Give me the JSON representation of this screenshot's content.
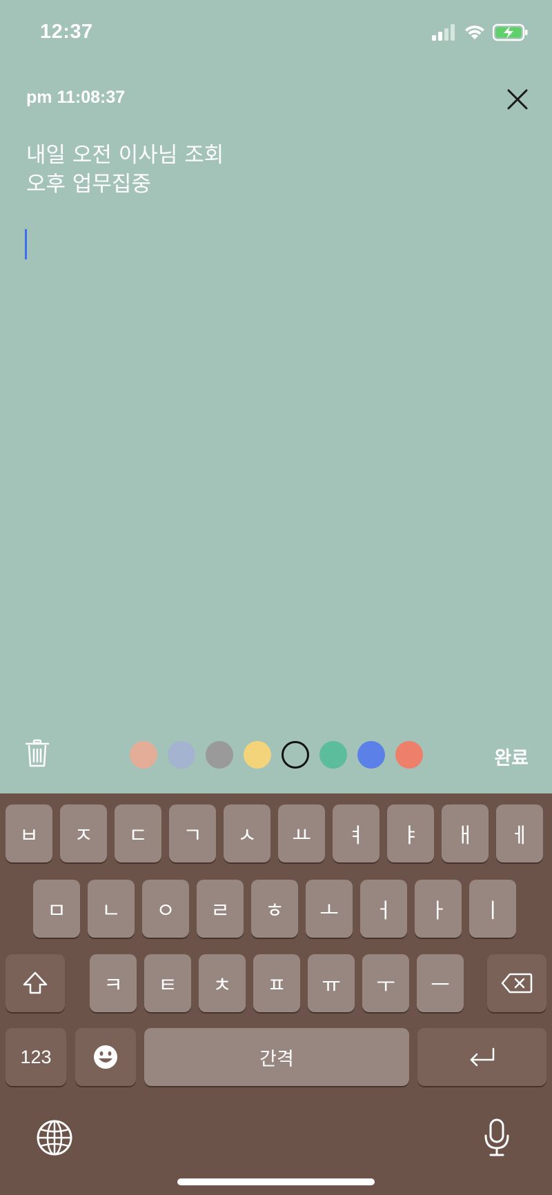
{
  "status_bar": {
    "time": "12:37"
  },
  "memo": {
    "timestamp": "pm 11:08:37",
    "lines": [
      "내일 오전 이사님 조회",
      "오후 업무집중"
    ]
  },
  "toolbar": {
    "done_label": "완료",
    "colors": [
      "#e4ad98",
      "#a4b3d0",
      "#9a9a9a",
      "#f4d47a",
      "#a3c2b8",
      "#5bbd9b",
      "#5b80e8",
      "#ee806b"
    ],
    "selected_color_index": 4
  },
  "keyboard": {
    "row1": [
      "ㅂ",
      "ㅈ",
      "ㄷ",
      "ㄱ",
      "ㅅ",
      "ㅛ",
      "ㅕ",
      "ㅑ",
      "ㅐ",
      "ㅔ"
    ],
    "row2": [
      "ㅁ",
      "ㄴ",
      "ㅇ",
      "ㄹ",
      "ㅎ",
      "ㅗ",
      "ㅓ",
      "ㅏ",
      "ㅣ"
    ],
    "row3": [
      "ㅋ",
      "ㅌ",
      "ㅊ",
      "ㅍ",
      "ㅠ",
      "ㅜ",
      "ㅡ"
    ],
    "numbers_label": "123",
    "space_label": "간격"
  },
  "icons": {
    "close": "close-icon",
    "trash": "trash-icon",
    "shift": "shift-icon",
    "backspace": "backspace-icon",
    "emoji": "emoji-icon",
    "return": "return-icon",
    "globe": "globe-icon",
    "mic": "microphone-icon"
  }
}
